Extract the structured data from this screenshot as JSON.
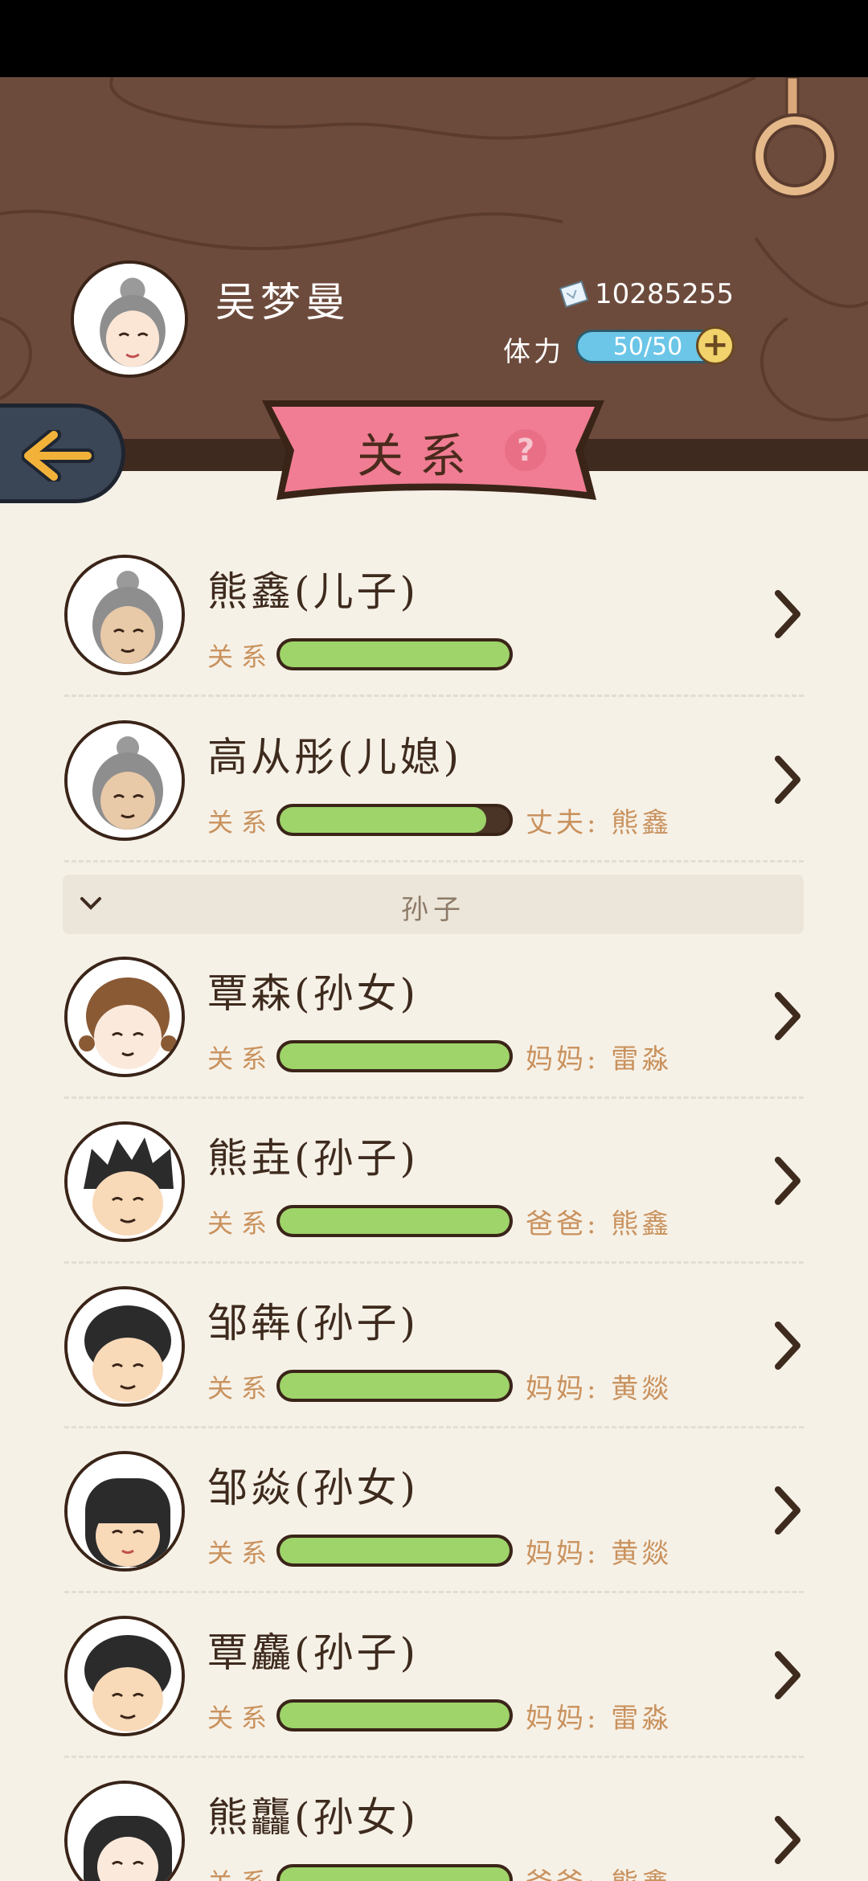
{
  "player": {
    "name": "吴梦曼",
    "money": "10285255",
    "stamina_label": "体力",
    "stamina_value": "50/50",
    "stamina_plus": "+"
  },
  "banner": {
    "title": "关系",
    "help": "?"
  },
  "relation_label": "关系",
  "group": {
    "title": "孙子"
  },
  "rows": [
    {
      "name": "熊鑫(儿子)",
      "relation": 1.0,
      "extra": "",
      "avatar": "elder-woman"
    },
    {
      "name": "高从彤(儿媳)",
      "relation": 0.9,
      "extra": "丈夫: 熊鑫",
      "avatar": "elder-woman"
    },
    {
      "name": "覃森(孙女)",
      "relation": 1.0,
      "extra": "妈妈: 雷淼",
      "avatar": "girl"
    },
    {
      "name": "熊垚(孙子)",
      "relation": 1.0,
      "extra": "爸爸: 熊鑫",
      "avatar": "boy-spiky"
    },
    {
      "name": "邹犇(孙子)",
      "relation": 1.0,
      "extra": "妈妈: 黄燚",
      "avatar": "boy"
    },
    {
      "name": "邹焱(孙女)",
      "relation": 1.0,
      "extra": "妈妈: 黄燚",
      "avatar": "girl-bangs"
    },
    {
      "name": "覃麤(孙子)",
      "relation": 1.0,
      "extra": "妈妈: 雷淼",
      "avatar": "boy"
    },
    {
      "name": "熊龘(孙女)",
      "relation": 1.0,
      "extra": "爸爸: 熊鑫",
      "avatar": "girl-long"
    }
  ],
  "icons": {
    "back": "arrow-left-icon",
    "chevron": "chevron-right-icon",
    "money": "ticket-icon",
    "group_toggle": "chevron-down-icon"
  },
  "colors": {
    "bar_fill": "#9ed46a",
    "banner": "#f07d93",
    "header_wood": "#6d4b3c"
  }
}
